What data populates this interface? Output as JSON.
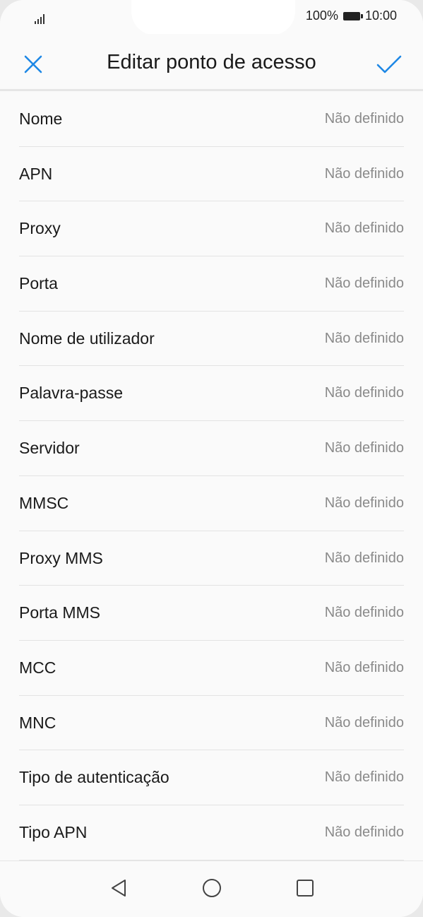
{
  "status": {
    "battery_text": "100%",
    "time": "10:00"
  },
  "header": {
    "title": "Editar ponto de acesso"
  },
  "rows": [
    {
      "label": "Nome",
      "value": "Não definido"
    },
    {
      "label": "APN",
      "value": "Não definido"
    },
    {
      "label": "Proxy",
      "value": "Não definido"
    },
    {
      "label": "Porta",
      "value": "Não definido"
    },
    {
      "label": "Nome de utilizador",
      "value": "Não definido"
    },
    {
      "label": "Palavra-passe",
      "value": "Não definido"
    },
    {
      "label": "Servidor",
      "value": "Não definido"
    },
    {
      "label": "MMSC",
      "value": "Não definido"
    },
    {
      "label": "Proxy MMS",
      "value": "Não definido"
    },
    {
      "label": "Porta MMS",
      "value": "Não definido"
    },
    {
      "label": "MCC",
      "value": "Não definido"
    },
    {
      "label": "MNC",
      "value": "Não definido"
    },
    {
      "label": "Tipo de autenticação",
      "value": "Não definido"
    },
    {
      "label": "Tipo APN",
      "value": "Não definido"
    }
  ],
  "colors": {
    "accent": "#1e88e5",
    "label": "#1a1a1a",
    "value": "#8a8a8a"
  },
  "icons": {
    "close": "close-icon",
    "confirm": "checkmark-icon",
    "back": "back-triangle-icon",
    "home": "home-circle-icon",
    "recent": "recent-apps-square-icon"
  }
}
